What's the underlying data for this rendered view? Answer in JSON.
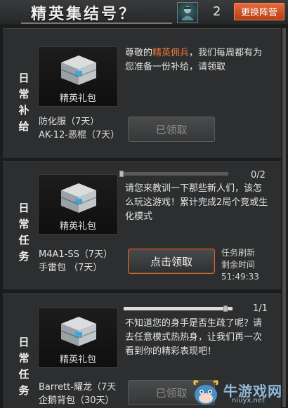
{
  "header": {
    "title": "精英集结号？",
    "count": "2",
    "change_button": "更换阵营"
  },
  "tasks": [
    {
      "side_label": [
        "日",
        "常",
        "补",
        "给"
      ],
      "reward_label": "精英礼包",
      "desc_prefix": "尊敬的",
      "desc_highlight": "精英佣兵",
      "desc_suffix": "，我们每周都有为您准备一份补给，请领取",
      "items": [
        "防化服（7天）",
        "AK-12-恶棍（7天）"
      ],
      "button": "已领取"
    },
    {
      "side_label": [
        "日",
        "常",
        "任",
        "务"
      ],
      "reward_label": "精英礼包",
      "progress_text": "0/2",
      "progress": 0.0,
      "desc": "请您来教训一下那些新人们，该怎么玩这游戏！累计完成2局个竞或生化模式",
      "items": [
        "M4A1-SS（7天）",
        "手雷包 （7天）"
      ],
      "button": "点击领取",
      "refresh_label": "任务刷新",
      "remaining_label": "剩余时间",
      "remaining_time": "51:49:33"
    },
    {
      "side_label": [
        "日",
        "常",
        "任",
        "务"
      ],
      "reward_label": "精英礼包",
      "progress_text": "1/1",
      "progress": 1.0,
      "desc": "不知道您的身手是否生疏了呢？请去任意模式热热身，让我们再一次看到你的精彩表现吧！",
      "items": [
        "Barrett-耀龙（7天",
        "企鹅背包（30天）"
      ],
      "button": "已领取"
    }
  ],
  "watermark": {
    "text": "牛游戏网",
    "url": "niuyx.net"
  },
  "icons": {
    "avatar": "soldier-avatar-icon",
    "chest": "supply-chest-icon",
    "logo": "cow-mascot-icon"
  }
}
